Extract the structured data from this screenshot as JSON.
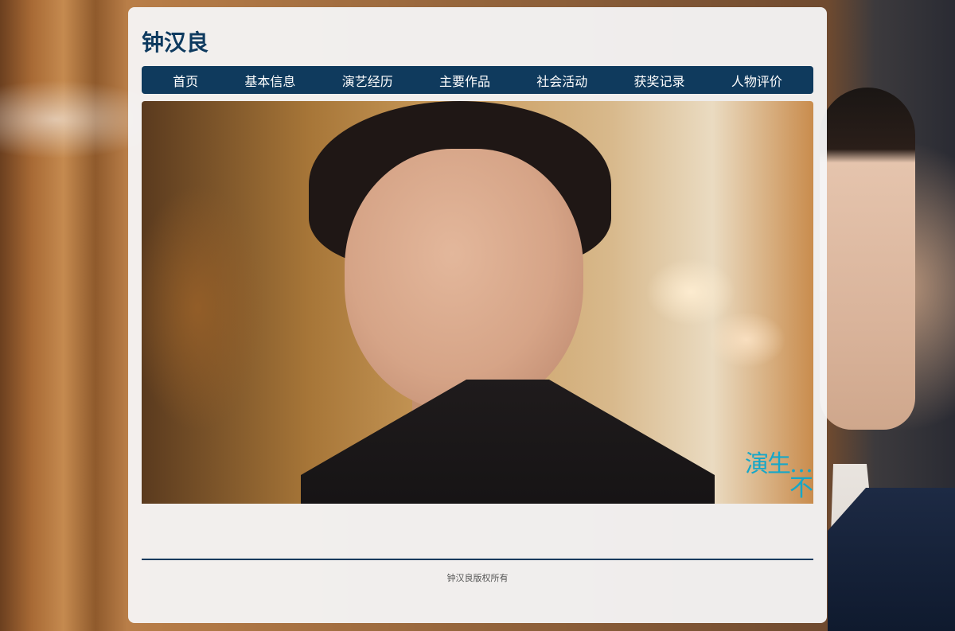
{
  "site": {
    "title": "钟汉良"
  },
  "nav": {
    "items": [
      {
        "label": "首页"
      },
      {
        "label": "基本信息"
      },
      {
        "label": "演艺经历"
      },
      {
        "label": "主要作品"
      },
      {
        "label": "社会活动"
      },
      {
        "label": "获奖记录"
      },
      {
        "label": "人物评价"
      }
    ]
  },
  "hero": {
    "overlay_text": "演生…不"
  },
  "footer": {
    "copyright": "钟汉良版权所有"
  },
  "colors": {
    "primary": "#0f3a5d",
    "title": "#0e3a5f",
    "card_bg": "#f6f6f7"
  }
}
